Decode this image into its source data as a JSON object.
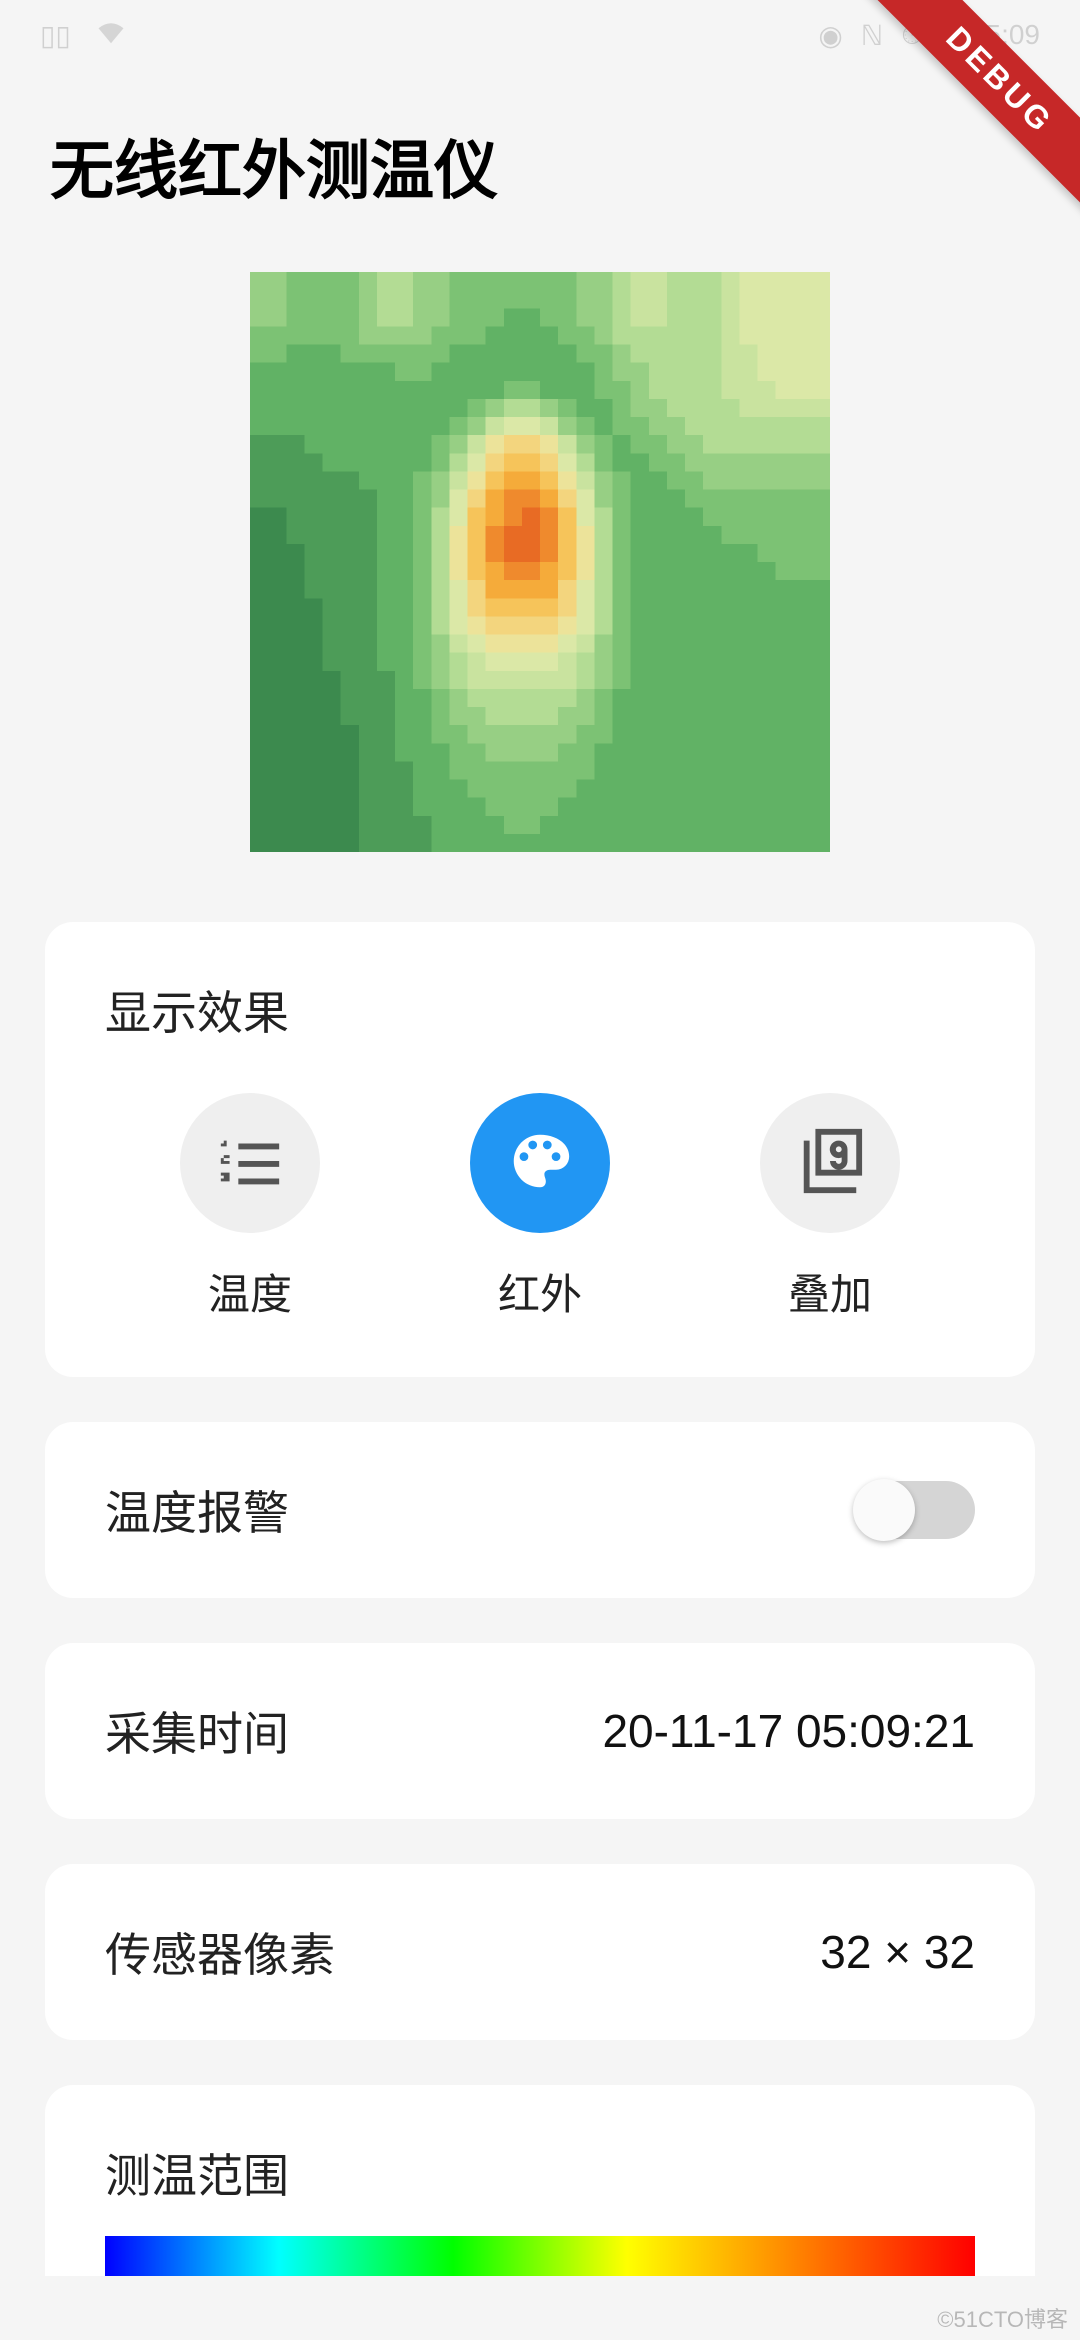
{
  "status": {
    "time": "5:09"
  },
  "debug_ribbon": "DEBUG",
  "title": "无线红外测温仪",
  "display_mode": {
    "section_title": "显示效果",
    "options": [
      {
        "label": "温度",
        "icon": "list-numbers-icon",
        "active": false
      },
      {
        "label": "红外",
        "icon": "palette-icon",
        "active": true
      },
      {
        "label": "叠加",
        "icon": "filter-9-icon",
        "active": false
      }
    ]
  },
  "alarm": {
    "label": "温度报警",
    "enabled": false
  },
  "capture_time": {
    "label": "采集时间",
    "value": "20-11-17 05:09:21"
  },
  "sensor_pixels": {
    "label": "传感器像素",
    "value": "32 × 32"
  },
  "temp_range": {
    "label": "测温范围"
  },
  "watermark": "©51CTO博客",
  "thermal": {
    "cols": 32,
    "rows": 32,
    "palette": [
      "#3c8a4e",
      "#4d9c58",
      "#61b265",
      "#7cc274",
      "#97cf84",
      "#b3dc94",
      "#c9e39f",
      "#dbe8a7",
      "#ece39a",
      "#f3d57e",
      "#f6c45a",
      "#f5ab3a",
      "#ef8a2d",
      "#e86b24"
    ],
    "data": [
      [
        4,
        4,
        3,
        3,
        3,
        3,
        4,
        5,
        5,
        4,
        4,
        3,
        3,
        3,
        3,
        3,
        3,
        3,
        4,
        4,
        5,
        6,
        6,
        5,
        5,
        5,
        6,
        7,
        7,
        7,
        7,
        7
      ],
      [
        4,
        4,
        3,
        3,
        3,
        3,
        4,
        5,
        5,
        4,
        4,
        3,
        3,
        3,
        3,
        3,
        3,
        3,
        4,
        4,
        5,
        6,
        6,
        5,
        5,
        5,
        6,
        7,
        7,
        7,
        7,
        7
      ],
      [
        4,
        4,
        3,
        3,
        3,
        3,
        4,
        5,
        5,
        4,
        4,
        3,
        3,
        3,
        2,
        2,
        3,
        3,
        4,
        4,
        5,
        6,
        6,
        5,
        5,
        5,
        6,
        7,
        7,
        7,
        7,
        7
      ],
      [
        3,
        3,
        3,
        3,
        3,
        3,
        4,
        4,
        4,
        4,
        3,
        3,
        3,
        2,
        2,
        2,
        2,
        3,
        3,
        4,
        5,
        5,
        5,
        5,
        5,
        5,
        6,
        7,
        7,
        7,
        7,
        7
      ],
      [
        3,
        3,
        2,
        2,
        2,
        3,
        3,
        3,
        3,
        3,
        3,
        2,
        2,
        2,
        2,
        2,
        2,
        2,
        3,
        3,
        4,
        5,
        5,
        5,
        5,
        5,
        6,
        6,
        7,
        7,
        7,
        7
      ],
      [
        2,
        2,
        2,
        2,
        2,
        2,
        2,
        2,
        3,
        3,
        2,
        2,
        2,
        2,
        2,
        2,
        2,
        2,
        2,
        3,
        4,
        4,
        5,
        5,
        5,
        5,
        6,
        6,
        7,
        7,
        7,
        7
      ],
      [
        2,
        2,
        2,
        2,
        2,
        2,
        2,
        2,
        2,
        2,
        2,
        2,
        2,
        2,
        3,
        3,
        2,
        2,
        2,
        3,
        3,
        4,
        5,
        5,
        5,
        5,
        6,
        6,
        6,
        7,
        7,
        7
      ],
      [
        2,
        2,
        2,
        2,
        2,
        2,
        2,
        2,
        2,
        2,
        2,
        2,
        3,
        4,
        5,
        5,
        4,
        3,
        2,
        2,
        3,
        4,
        4,
        5,
        5,
        5,
        5,
        6,
        6,
        6,
        6,
        6
      ],
      [
        2,
        2,
        2,
        2,
        2,
        2,
        2,
        2,
        2,
        2,
        2,
        3,
        4,
        6,
        7,
        7,
        6,
        4,
        3,
        2,
        3,
        3,
        4,
        4,
        5,
        5,
        5,
        5,
        5,
        5,
        5,
        5
      ],
      [
        1,
        1,
        1,
        2,
        2,
        2,
        2,
        2,
        2,
        2,
        3,
        4,
        6,
        8,
        9,
        9,
        8,
        6,
        4,
        3,
        2,
        3,
        3,
        4,
        4,
        5,
        5,
        5,
        5,
        5,
        5,
        5
      ],
      [
        1,
        1,
        1,
        1,
        2,
        2,
        2,
        2,
        2,
        2,
        3,
        5,
        7,
        9,
        10,
        10,
        9,
        7,
        5,
        3,
        2,
        2,
        3,
        3,
        4,
        4,
        4,
        4,
        4,
        4,
        4,
        4
      ],
      [
        1,
        1,
        1,
        1,
        1,
        1,
        2,
        2,
        2,
        3,
        4,
        6,
        8,
        10,
        11,
        11,
        10,
        8,
        6,
        4,
        3,
        2,
        2,
        3,
        3,
        4,
        4,
        4,
        4,
        4,
        4,
        4
      ],
      [
        1,
        1,
        1,
        1,
        1,
        1,
        1,
        2,
        2,
        3,
        4,
        7,
        9,
        11,
        12,
        12,
        11,
        9,
        7,
        4,
        3,
        2,
        2,
        2,
        3,
        3,
        3,
        3,
        3,
        3,
        3,
        3
      ],
      [
        0,
        0,
        1,
        1,
        1,
        1,
        1,
        2,
        2,
        3,
        5,
        7,
        10,
        11,
        12,
        13,
        12,
        10,
        7,
        5,
        3,
        2,
        2,
        2,
        2,
        3,
        3,
        3,
        3,
        3,
        3,
        3
      ],
      [
        0,
        0,
        1,
        1,
        1,
        1,
        1,
        2,
        2,
        3,
        5,
        8,
        10,
        12,
        13,
        13,
        12,
        10,
        8,
        5,
        3,
        2,
        2,
        2,
        2,
        2,
        3,
        3,
        3,
        3,
        3,
        3
      ],
      [
        0,
        0,
        0,
        1,
        1,
        1,
        1,
        2,
        2,
        3,
        5,
        8,
        10,
        12,
        13,
        13,
        12,
        10,
        8,
        5,
        3,
        2,
        2,
        2,
        2,
        2,
        2,
        2,
        3,
        3,
        3,
        3
      ],
      [
        0,
        0,
        0,
        1,
        1,
        1,
        1,
        2,
        2,
        3,
        5,
        8,
        10,
        11,
        12,
        12,
        11,
        10,
        8,
        5,
        3,
        2,
        2,
        2,
        2,
        2,
        2,
        2,
        2,
        3,
        3,
        3
      ],
      [
        0,
        0,
        0,
        1,
        1,
        1,
        1,
        2,
        2,
        3,
        5,
        7,
        9,
        11,
        11,
        11,
        11,
        9,
        7,
        5,
        3,
        2,
        2,
        2,
        2,
        2,
        2,
        2,
        2,
        2,
        2,
        2
      ],
      [
        0,
        0,
        0,
        0,
        1,
        1,
        1,
        2,
        2,
        3,
        5,
        7,
        9,
        10,
        10,
        10,
        10,
        9,
        7,
        5,
        3,
        2,
        2,
        2,
        2,
        2,
        2,
        2,
        2,
        2,
        2,
        2
      ],
      [
        0,
        0,
        0,
        0,
        1,
        1,
        1,
        2,
        2,
        3,
        5,
        7,
        8,
        9,
        9,
        9,
        9,
        8,
        7,
        5,
        3,
        2,
        2,
        2,
        2,
        2,
        2,
        2,
        2,
        2,
        2,
        2
      ],
      [
        0,
        0,
        0,
        0,
        1,
        1,
        1,
        2,
        2,
        3,
        4,
        6,
        7,
        8,
        8,
        8,
        8,
        7,
        6,
        4,
        3,
        2,
        2,
        2,
        2,
        2,
        2,
        2,
        2,
        2,
        2,
        2
      ],
      [
        0,
        0,
        0,
        0,
        1,
        1,
        1,
        2,
        2,
        3,
        4,
        5,
        6,
        7,
        7,
        7,
        7,
        6,
        5,
        4,
        3,
        2,
        2,
        2,
        2,
        2,
        2,
        2,
        2,
        2,
        2,
        2
      ],
      [
        0,
        0,
        0,
        0,
        0,
        1,
        1,
        1,
        2,
        3,
        4,
        5,
        6,
        6,
        6,
        6,
        6,
        6,
        5,
        4,
        3,
        2,
        2,
        2,
        2,
        2,
        2,
        2,
        2,
        2,
        2,
        2
      ],
      [
        0,
        0,
        0,
        0,
        0,
        1,
        1,
        1,
        2,
        2,
        3,
        4,
        5,
        5,
        5,
        5,
        5,
        5,
        4,
        3,
        2,
        2,
        2,
        2,
        2,
        2,
        2,
        2,
        2,
        2,
        2,
        2
      ],
      [
        0,
        0,
        0,
        0,
        0,
        1,
        1,
        1,
        2,
        2,
        3,
        4,
        4,
        5,
        5,
        5,
        5,
        4,
        4,
        3,
        2,
        2,
        2,
        2,
        2,
        2,
        2,
        2,
        2,
        2,
        2,
        2
      ],
      [
        0,
        0,
        0,
        0,
        0,
        0,
        1,
        1,
        2,
        2,
        3,
        3,
        4,
        4,
        4,
        4,
        4,
        4,
        3,
        3,
        2,
        2,
        2,
        2,
        2,
        2,
        2,
        2,
        2,
        2,
        2,
        2
      ],
      [
        0,
        0,
        0,
        0,
        0,
        0,
        1,
        1,
        2,
        2,
        2,
        3,
        3,
        4,
        4,
        4,
        4,
        3,
        3,
        2,
        2,
        2,
        2,
        2,
        2,
        2,
        2,
        2,
        2,
        2,
        2,
        2
      ],
      [
        0,
        0,
        0,
        0,
        0,
        0,
        1,
        1,
        1,
        2,
        2,
        3,
        3,
        3,
        3,
        3,
        3,
        3,
        3,
        2,
        2,
        2,
        2,
        2,
        2,
        2,
        2,
        2,
        2,
        2,
        2,
        2
      ],
      [
        0,
        0,
        0,
        0,
        0,
        0,
        1,
        1,
        1,
        2,
        2,
        2,
        3,
        3,
        3,
        3,
        3,
        3,
        2,
        2,
        2,
        2,
        2,
        2,
        2,
        2,
        2,
        2,
        2,
        2,
        2,
        2
      ],
      [
        0,
        0,
        0,
        0,
        0,
        0,
        1,
        1,
        1,
        2,
        2,
        2,
        2,
        3,
        3,
        3,
        3,
        2,
        2,
        2,
        2,
        2,
        2,
        2,
        2,
        2,
        2,
        2,
        2,
        2,
        2,
        2
      ],
      [
        0,
        0,
        0,
        0,
        0,
        0,
        1,
        1,
        1,
        1,
        2,
        2,
        2,
        2,
        3,
        3,
        2,
        2,
        2,
        2,
        2,
        2,
        2,
        2,
        2,
        2,
        2,
        2,
        2,
        2,
        2,
        2
      ],
      [
        0,
        0,
        0,
        0,
        0,
        0,
        1,
        1,
        1,
        1,
        2,
        2,
        2,
        2,
        2,
        2,
        2,
        2,
        2,
        2,
        2,
        2,
        2,
        2,
        2,
        2,
        2,
        2,
        2,
        2,
        2,
        2
      ]
    ]
  }
}
